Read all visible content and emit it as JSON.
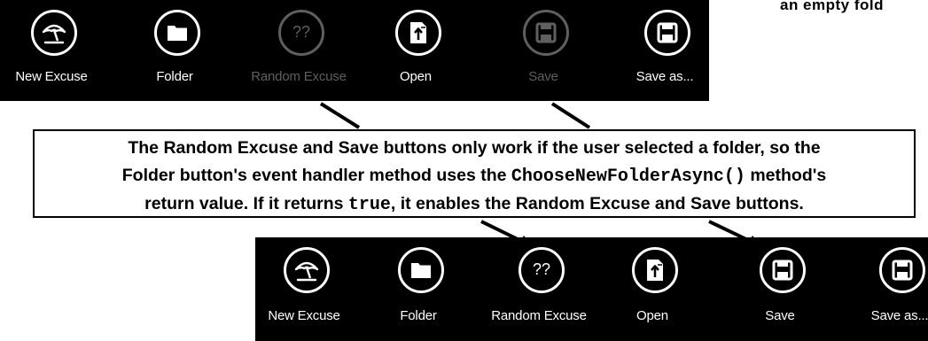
{
  "corner_text": "an empty fold",
  "top_appbar": {
    "buttons": [
      {
        "label": "New Excuse",
        "icon": "umbrella-icon",
        "enabled": true
      },
      {
        "label": "Folder",
        "icon": "folder-icon",
        "enabled": true
      },
      {
        "label": "Random Excuse",
        "icon": "question-marks-icon",
        "icon_text": "??",
        "enabled": false
      },
      {
        "label": "Open",
        "icon": "open-file-icon",
        "enabled": true
      },
      {
        "label": "Save",
        "icon": "floppy-disk-icon",
        "enabled": false
      },
      {
        "label": "Save as...",
        "icon": "floppy-disk-icon",
        "enabled": true
      }
    ]
  },
  "callout": {
    "line1": "The Random Excuse and Save buttons only work if the user selected a folder, so the",
    "line2_a": "Folder button's event handler method uses the ",
    "line2_code": "ChooseNewFolderAsync()",
    "line2_b": " method's",
    "line3_a": "return value. If it returns ",
    "line3_code": "true",
    "line3_b": ", it enables the Random Excuse and Save buttons."
  },
  "bottom_appbar": {
    "buttons": [
      {
        "label": "New Excuse",
        "icon": "umbrella-icon",
        "enabled": true
      },
      {
        "label": "Folder",
        "icon": "folder-icon",
        "enabled": true
      },
      {
        "label": "Random Excuse",
        "icon": "question-marks-icon",
        "icon_text": "??",
        "enabled": true
      },
      {
        "label": "Open",
        "icon": "open-file-icon",
        "enabled": true
      },
      {
        "label": "Save",
        "icon": "floppy-disk-icon",
        "enabled": true
      },
      {
        "label": "Save as...",
        "icon": "floppy-disk-icon",
        "enabled": true
      }
    ]
  },
  "colors": {
    "appbar_background": "#000000",
    "enabled_foreground": "#ffffff",
    "disabled_foreground": "#5f5f5f",
    "page_background": "#ffffff"
  }
}
